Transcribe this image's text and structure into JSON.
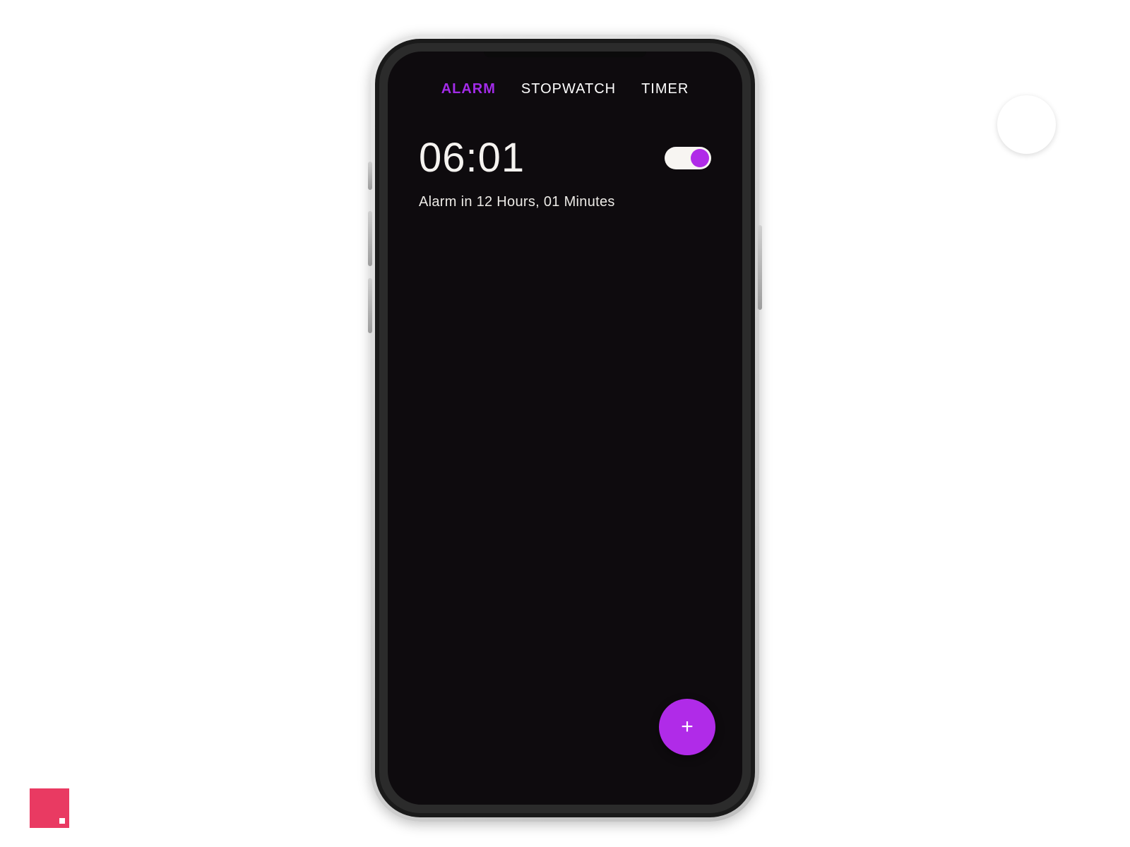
{
  "colors": {
    "accent": "#b02be8",
    "tab_active": "#a22be8",
    "screen_bg": "#0e0b0e",
    "decor_pink": "#e93a62"
  },
  "tabs": [
    {
      "label": "ALARM",
      "active": true
    },
    {
      "label": "STOPWATCH",
      "active": false
    },
    {
      "label": "TIMER",
      "active": false
    }
  ],
  "alarm": {
    "time": "06:01",
    "subtitle": "Alarm in 12 Hours, 01 Minutes",
    "enabled": true
  },
  "fab": {
    "label": "+"
  }
}
